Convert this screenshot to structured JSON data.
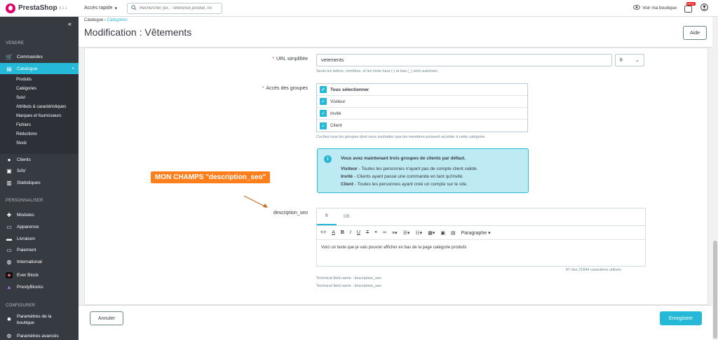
{
  "topbar": {
    "brand": "PrestaShop",
    "version": "8.1.1",
    "quick_access": "Accès rapide",
    "search_placeholder": "Rechercher (ex. : référence produit, no",
    "view_shop": "Voir ma boutique",
    "notif_badge": "NEW"
  },
  "sidebar": {
    "sections": [
      "VENDRE",
      "PERSONNALISER",
      "CONFIGURER"
    ],
    "items": [
      {
        "label": "Commandes",
        "icon": "cart-icon"
      },
      {
        "label": "Catalogue",
        "icon": "catalog-icon"
      },
      {
        "label": "Clients",
        "icon": "customer-icon"
      },
      {
        "label": "SAV",
        "icon": "chat-icon"
      },
      {
        "label": "Statistiques",
        "icon": "stats-icon"
      },
      {
        "label": "Modules",
        "icon": "puzzle-icon"
      },
      {
        "label": "Apparence",
        "icon": "monitor-icon"
      },
      {
        "label": "Livraison",
        "icon": "truck-icon"
      },
      {
        "label": "Paiement",
        "icon": "card-icon"
      },
      {
        "label": "International",
        "icon": "globe-icon"
      },
      {
        "label": "Ever Block",
        "icon": "everblock-icon"
      },
      {
        "label": "PrestyBlocks",
        "icon": "presty-icon"
      },
      {
        "label": "Paramètres de la boutique",
        "icon": "gear-icon"
      },
      {
        "label": "Paramètres avancés",
        "icon": "cog-icon"
      }
    ],
    "catalogue_sub": [
      "Produits",
      "Catégories",
      "Suivi",
      "Attributs & caractéristiques",
      "Marques et fournisseurs",
      "Fichiers",
      "Réductions",
      "Stock"
    ]
  },
  "header": {
    "breadcrumb": [
      "Catalogue",
      "Catégories"
    ],
    "title": "Modification : Vêtements",
    "help": "Aide"
  },
  "form": {
    "url_label": "URL simplifiée",
    "url_value": "vetements",
    "lang": "fr",
    "url_help": "Seuls les lettres, nombres, et les tirets haut (-) et bas (_) sont autorisés.",
    "groups_label": "Accès des groupes",
    "groups": [
      "Tous sélectionner",
      "Visiteur",
      "Invité",
      "Client"
    ],
    "groups_help": "Cochez tous les groupes dont vous souhaitez que les membres puissent accéder à cette catégorie.",
    "info_title": "Vous avez maintenant trois groupes de clients par défaut.",
    "info_lines": [
      {
        "term": "Visiteur",
        "text": " - Toutes les personnes n'ayant pas de compte client valide."
      },
      {
        "term": "Invité",
        "text": " - Clients ayant passé une commande en tant qu'invité."
      },
      {
        "term": "Client",
        "text": " - Toutes les personnes ayant créé un compte sur le site."
      }
    ],
    "annotation": "MON CHAMPS \"description_seo\"",
    "desc_label": "description_seo",
    "editor_tabs": [
      "fr",
      "GB"
    ],
    "paragraph": "Paragraphe",
    "editor_text": "Voici un texte que je vais pouvoir afficher en bas de la page catégorie produits",
    "counter": "87 des 21844 caractères utilisés",
    "tech1": "Technical field name : description_seo",
    "tech2": "Technical field name : description_seo"
  },
  "footer": {
    "cancel": "Annuler",
    "save": "Enregistrer"
  },
  "colors": {
    "accent": "#25b9d7",
    "sidebar": "#363a41",
    "annotation": "#ff7e1c"
  }
}
